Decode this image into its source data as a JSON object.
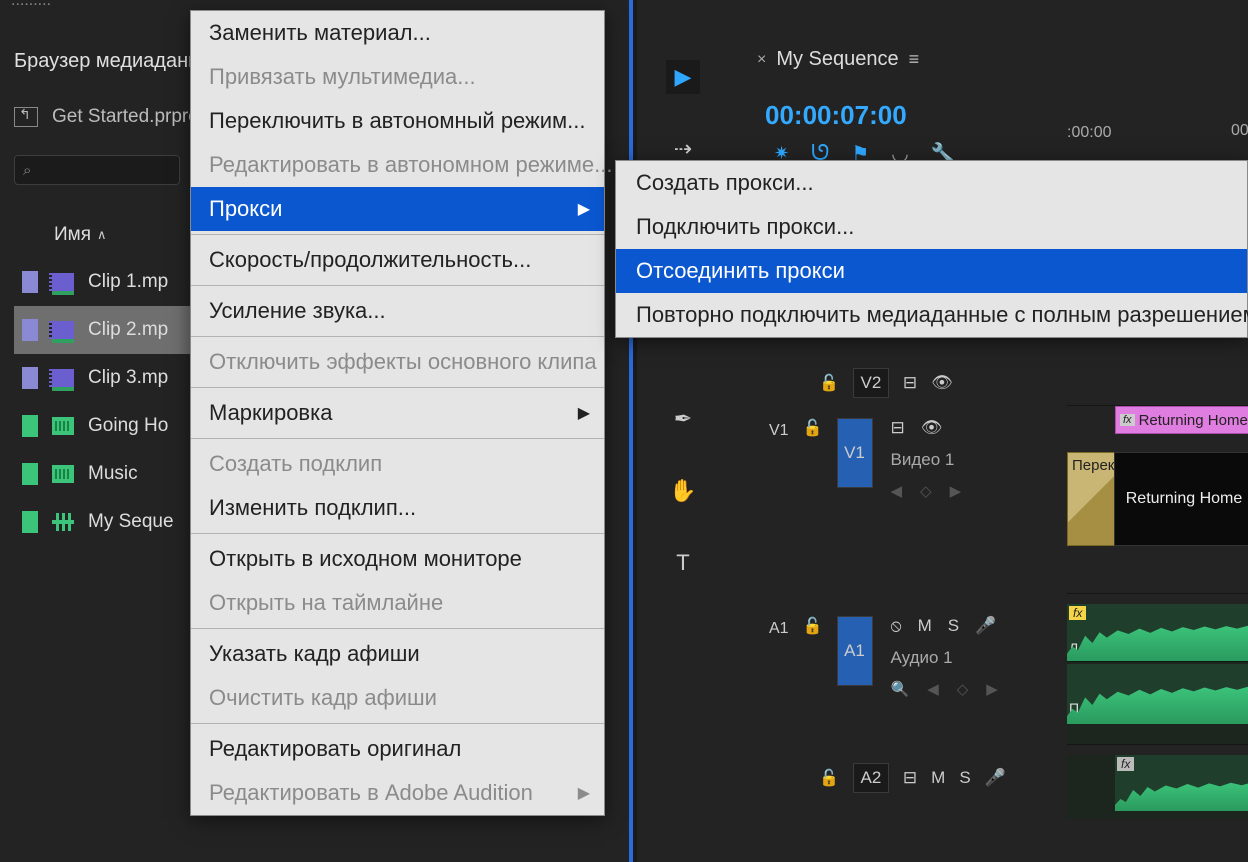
{
  "project": {
    "top_timecode": ".........",
    "browser_title": "Браузер медиаданных",
    "folder_up": "↰",
    "project_file": "Get Started.prproj",
    "search_placeholder": "",
    "name_header": "Имя",
    "sort_indicator": "∧",
    "items": [
      {
        "label": "Clip 1.mp",
        "tag": "blue",
        "icon": "vid",
        "selected": false
      },
      {
        "label": "Clip 2.mp",
        "tag": "blue",
        "icon": "vid",
        "selected": true
      },
      {
        "label": "Clip 3.mp",
        "tag": "blue",
        "icon": "vid",
        "selected": false
      },
      {
        "label": "Going Ho",
        "tag": "green",
        "icon": "aud",
        "selected": false
      },
      {
        "label": "Music",
        "tag": "green",
        "icon": "aud",
        "selected": false
      },
      {
        "label": "My Seque",
        "tag": "green",
        "icon": "seq",
        "selected": false
      }
    ]
  },
  "context_menu": {
    "items": [
      {
        "label": "Заменить материал...",
        "enabled": true
      },
      {
        "label": "Привязать мультимедиа...",
        "enabled": false
      },
      {
        "label": "Переключить в автономный режим...",
        "enabled": true
      },
      {
        "label": "Редактировать в автономном режиме...",
        "enabled": false
      },
      {
        "label": "Прокси",
        "enabled": true,
        "highlight": true,
        "submenu": true
      },
      {
        "sep": true
      },
      {
        "label": "Скорость/продолжительность...",
        "enabled": true
      },
      {
        "sep": true
      },
      {
        "label": "Усиление звука...",
        "enabled": true
      },
      {
        "sep": true
      },
      {
        "label": "Отключить эффекты основного клипа",
        "enabled": false
      },
      {
        "sep": true
      },
      {
        "label": "Маркировка",
        "enabled": true,
        "submenu": true
      },
      {
        "sep": true
      },
      {
        "label": "Создать подклип",
        "enabled": false
      },
      {
        "label": "Изменить подклип...",
        "enabled": true
      },
      {
        "sep": true
      },
      {
        "label": "Открыть в исходном мониторе",
        "enabled": true
      },
      {
        "label": "Открыть на таймлайне",
        "enabled": false
      },
      {
        "sep": true
      },
      {
        "label": "Указать кадр афиши",
        "enabled": true
      },
      {
        "label": "Очистить кадр афиши",
        "enabled": false
      },
      {
        "sep": true
      },
      {
        "label": "Редактировать оригинал",
        "enabled": true
      },
      {
        "label": "Редактировать в Adobe Audition",
        "enabled": false,
        "submenu": true
      }
    ]
  },
  "submenu": {
    "items": [
      {
        "label": "Создать прокси..."
      },
      {
        "label": "Подключить прокси..."
      },
      {
        "label": "Отсоединить прокси",
        "highlight": true
      },
      {
        "label": "Повторно подключить медиаданные с полным разрешением..."
      }
    ]
  },
  "timeline": {
    "tab_close": "×",
    "tab_name": "My Sequence",
    "tab_menu": "≡",
    "timecode": "00:00:07:00",
    "ruler_start": ":00:00",
    "ruler_end": "00",
    "tools": {
      "selection": "▶",
      "ripple": "⇢",
      "pen": "✒",
      "hand": "✋",
      "text": "T"
    },
    "toolbar": {
      "snap": "✷",
      "magnet": "ᘎ",
      "marker": "⚑",
      "cc": "◡",
      "wrench": "🔧"
    },
    "tracks": {
      "v2": {
        "lock": "🔓",
        "label": "V2",
        "sync": "⊟",
        "eye": "👁"
      },
      "v1": {
        "src": "V1",
        "lock": "🔓",
        "label": "V1",
        "name": "Видео 1",
        "sync": "⊟",
        "eye": "👁",
        "prev": "◀",
        "key": "◇",
        "next": "▶"
      },
      "a1": {
        "src": "A1",
        "lock": "🔓",
        "label": "A1",
        "name": "Аудио 1",
        "mute": "M",
        "solo": "S",
        "mic": "🎤",
        "nofx": "⦸",
        "zoom": "🔍",
        "prev": "◀",
        "key": "◇",
        "next": "▶"
      },
      "a2": {
        "lock": "🔓",
        "label": "A2",
        "mute": "M",
        "solo": "S",
        "mic": "🎤",
        "sync": "⊟"
      }
    },
    "clips": {
      "title_fx": "fx",
      "title_name": "Returning Home",
      "transition": "Перек",
      "v1_name": "Returning Home",
      "a1_fx": "fx",
      "a1_name_l": "Л",
      "a1_name_r": "П",
      "a2_fx": "fx"
    }
  }
}
